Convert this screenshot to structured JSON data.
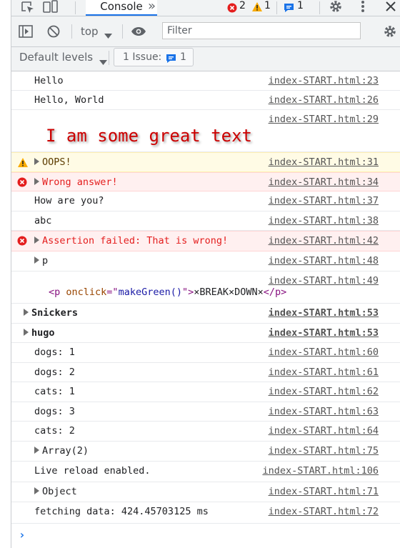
{
  "tabbar": {
    "active_tab": "Console",
    "more_tabs": "»",
    "error_count": "2",
    "warning_count": "1",
    "info_count": "1"
  },
  "toolbar": {
    "context": "top",
    "filter_placeholder": "Filter",
    "levels_label": "Default levels",
    "issue_label": "1 Issue:",
    "issue_count": "1"
  },
  "messages": [
    {
      "text": "Hello",
      "source": "index-START.html:23"
    },
    {
      "text": "Hello, World",
      "source": "index-START.html:26"
    },
    {
      "text": "I am some great text",
      "source": "index-START.html:29"
    },
    {
      "text": "OOPS!",
      "source": "index-START.html:31",
      "level": "warning"
    },
    {
      "text": "Wrong answer!",
      "source": "index-START.html:34",
      "level": "error"
    },
    {
      "text": "How are you?",
      "source": "index-START.html:37"
    },
    {
      "text": "abc",
      "source": "index-START.html:38"
    },
    {
      "text": "Assertion failed: That is wrong!",
      "source": "index-START.html:42",
      "level": "error"
    },
    {
      "text": "p",
      "source": "index-START.html:48"
    },
    {
      "text": "",
      "source": "index-START.html:49",
      "element": {
        "open": "<p ",
        "attr_name": "onclick",
        "attr_eq": "=\"",
        "attr_value": "makeGreen()",
        "close_attr": "\">",
        "content": "×BREAK×DOWN×",
        "close": "</p>"
      }
    },
    {
      "text": "Snickers",
      "source": "index-START.html:53"
    },
    {
      "text": "hugo",
      "source": "index-START.html:53"
    },
    {
      "text": "dogs: 1",
      "source": "index-START.html:60"
    },
    {
      "text": "dogs: 2",
      "source": "index-START.html:61"
    },
    {
      "text": "cats: 1",
      "source": "index-START.html:62"
    },
    {
      "text": "dogs: 3",
      "source": "index-START.html:63"
    },
    {
      "text": "cats: 2",
      "source": "index-START.html:64"
    },
    {
      "text": "Array(2)",
      "source": "index-START.html:75"
    },
    {
      "text": "Live reload enabled.",
      "source": "index-START.html:106"
    },
    {
      "text": "Object",
      "source": "index-START.html:71"
    },
    {
      "text": "fetching data: 424.45703125 ms",
      "source": "index-START.html:72"
    }
  ],
  "prompt": "›",
  "colors": {
    "accent": "#1a73e8",
    "error": "#e41e1e",
    "warning": "#f9ab00",
    "styled_text": "#cc0000"
  }
}
